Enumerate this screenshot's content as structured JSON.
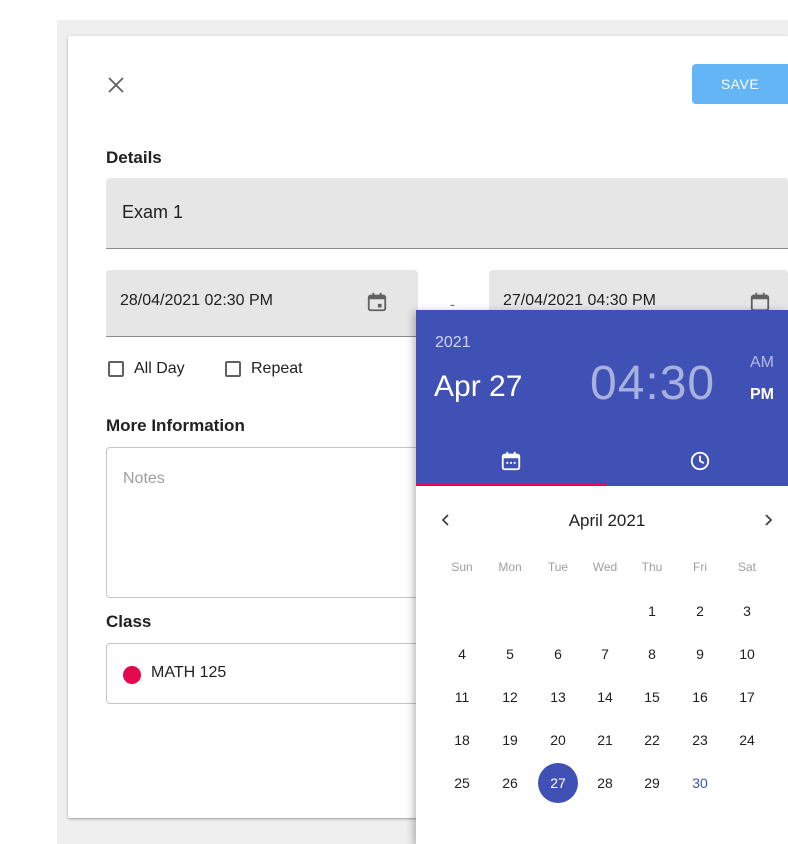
{
  "dialog": {
    "save_label": "SAVE",
    "details_label": "Details",
    "title_value": "Exam 1",
    "start_date": "28/04/2021 02:30 PM",
    "date_separator": "-",
    "end_date": "27/04/2021 04:30 PM",
    "all_day_label": "All Day",
    "repeat_label": "Repeat",
    "more_info_label": "More Information",
    "notes_placeholder": "Notes",
    "class_label": "Class",
    "class_value": "MATH 125",
    "class_color": "#e3094f"
  },
  "picker": {
    "year": "2021",
    "date": "Apr 27",
    "hour": "04",
    "colon": ":",
    "minute": "30",
    "am": "AM",
    "pm": "PM",
    "active_tab": "date",
    "month_label": "April 2021",
    "weekdays": [
      "Sun",
      "Mon",
      "Tue",
      "Wed",
      "Thu",
      "Fri",
      "Sat"
    ],
    "days": [
      "1",
      "2",
      "3",
      "4",
      "5",
      "6",
      "7",
      "8",
      "9",
      "10",
      "11",
      "12",
      "13",
      "14",
      "15",
      "16",
      "17",
      "18",
      "19",
      "20",
      "21",
      "22",
      "23",
      "24",
      "25",
      "26",
      "27",
      "28",
      "29",
      "30"
    ],
    "selected_day": "27",
    "today_day": "30",
    "header_color": "#3f51b5",
    "indicator_color": "#f50057"
  },
  "icons": {
    "close": "close-icon",
    "calendar": "calendar-icon",
    "clock": "clock-icon",
    "prev": "chevron-left-icon",
    "next": "chevron-right-icon"
  }
}
